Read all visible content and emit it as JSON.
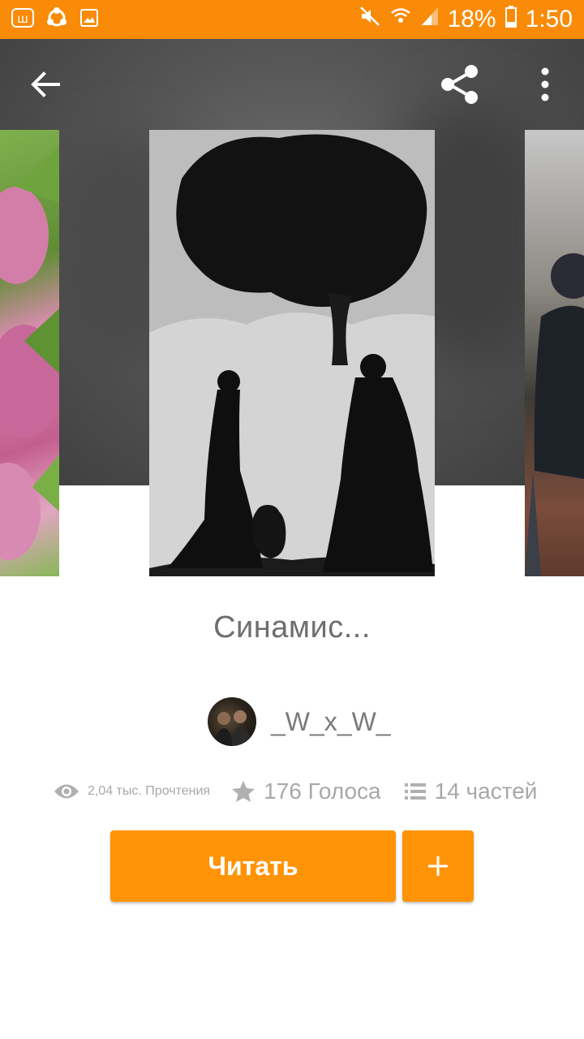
{
  "status_bar": {
    "battery": "18%",
    "time": "1:50",
    "icons": [
      "wattpad-icon",
      "sync-icon",
      "image-icon",
      "mute-icon",
      "wifi-icon",
      "signal-icon",
      "battery-icon"
    ]
  },
  "toolbar": {
    "back_icon": "arrow-back-icon",
    "share_icon": "share-icon",
    "more_icon": "more-vert-icon"
  },
  "story": {
    "title": "Синамис...",
    "author": "_W_x_W_",
    "reads": "2,04 тыс. Прочтения",
    "votes": "176 Голоса",
    "parts": "14 частей"
  },
  "actions": {
    "read_label": "Читать",
    "add_icon": "plus-icon"
  },
  "colors": {
    "accent": "#ff9409",
    "status_bar": "#f98b08"
  }
}
